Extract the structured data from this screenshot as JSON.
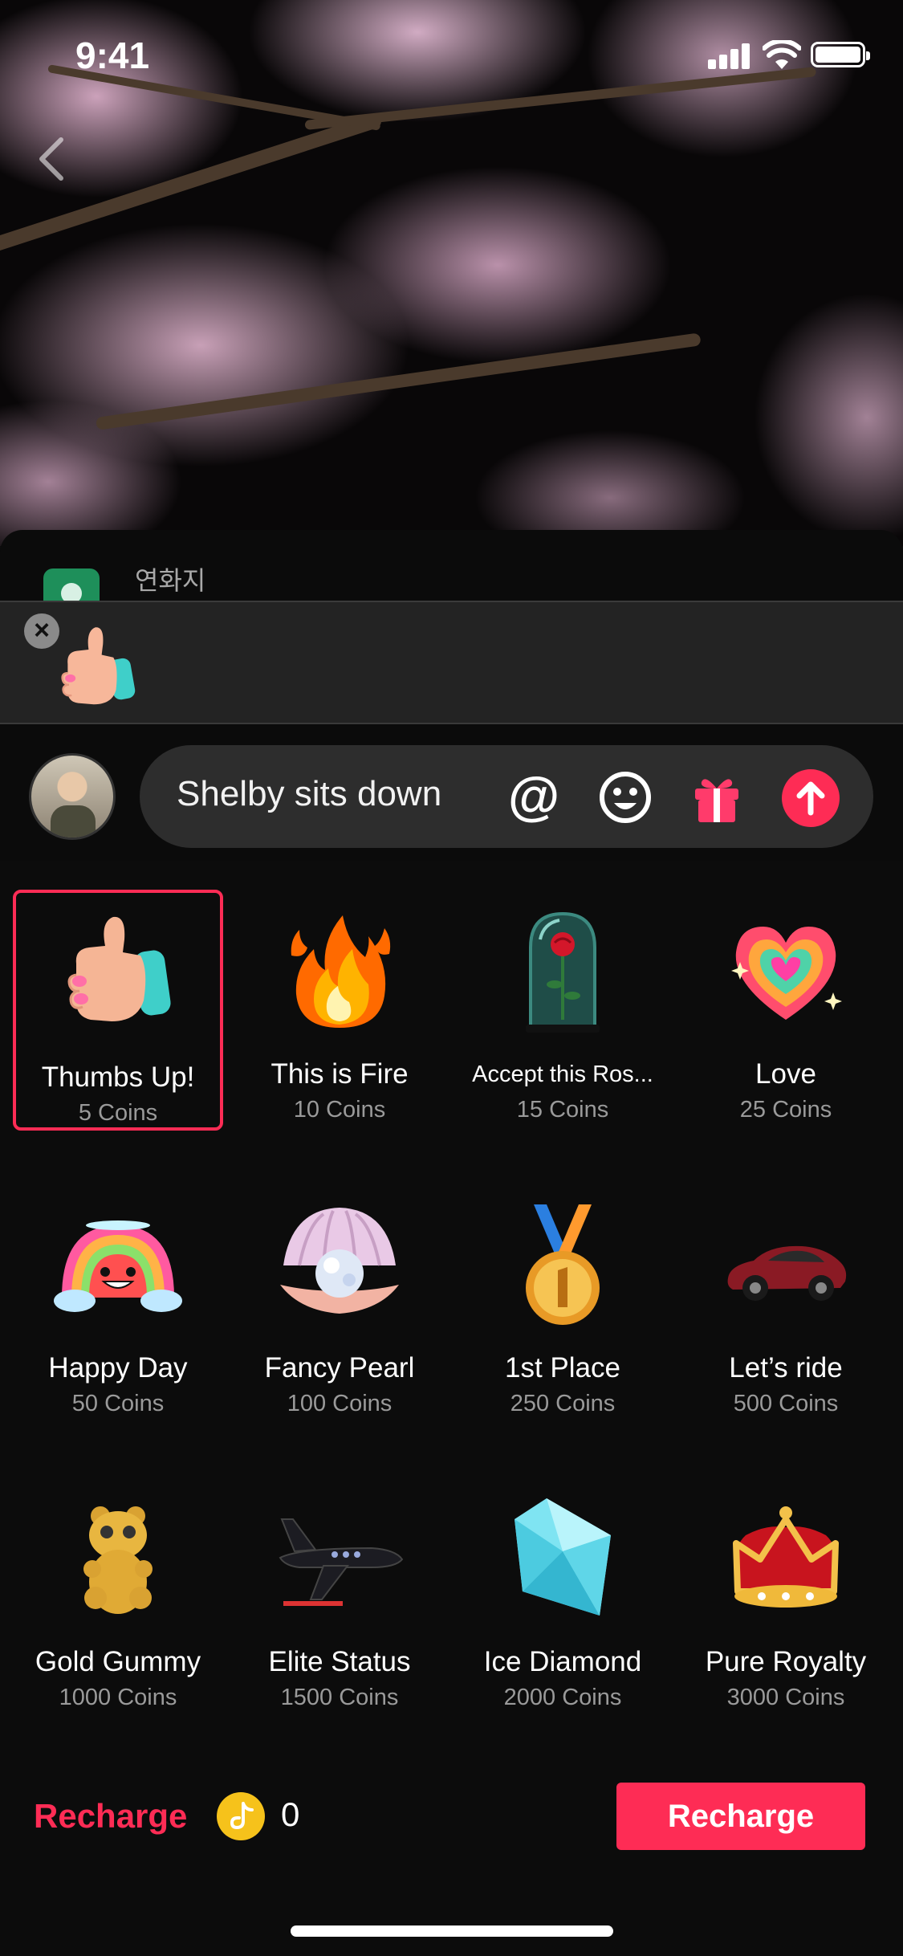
{
  "status_bar": {
    "time": "9:41"
  },
  "comment_preview": {
    "username": "연화지"
  },
  "tray": {
    "close_label": "×",
    "selected_gift_icon": "thumbs-up-icon"
  },
  "composer": {
    "text": "Shelby sits down",
    "at_label": "@"
  },
  "gifts": [
    {
      "name": "Thumbs Up!",
      "price": "5 Coins",
      "icon": "thumbs-up-icon",
      "selected": true
    },
    {
      "name": "This is Fire",
      "price": "10 Coins",
      "icon": "fire-icon"
    },
    {
      "name": "Accept this Ros...",
      "price": "15 Coins",
      "icon": "rose-dome-icon"
    },
    {
      "name": "Love",
      "price": "25 Coins",
      "icon": "heart-icon"
    },
    {
      "name": "Happy Day",
      "price": "50 Coins",
      "icon": "rainbow-icon"
    },
    {
      "name": "Fancy Pearl",
      "price": "100 Coins",
      "icon": "pearl-icon"
    },
    {
      "name": "1st Place",
      "price": "250 Coins",
      "icon": "medal-icon"
    },
    {
      "name": "Let’s ride",
      "price": "500 Coins",
      "icon": "car-icon"
    },
    {
      "name": "Gold Gummy",
      "price": "1000 Coins",
      "icon": "gummy-bear-icon"
    },
    {
      "name": "Elite Status",
      "price": "1500 Coins",
      "icon": "jet-icon"
    },
    {
      "name": "Ice Diamond",
      "price": "2000 Coins",
      "icon": "diamond-icon"
    },
    {
      "name": "Pure Royalty",
      "price": "3000 Coins",
      "icon": "crown-icon"
    }
  ],
  "footer": {
    "recharge_link": "Recharge",
    "balance": "0",
    "recharge_button": "Recharge"
  },
  "colors": {
    "accent": "#fe2c55",
    "coin": "#f6c21b",
    "background": "#0c0c0c"
  }
}
